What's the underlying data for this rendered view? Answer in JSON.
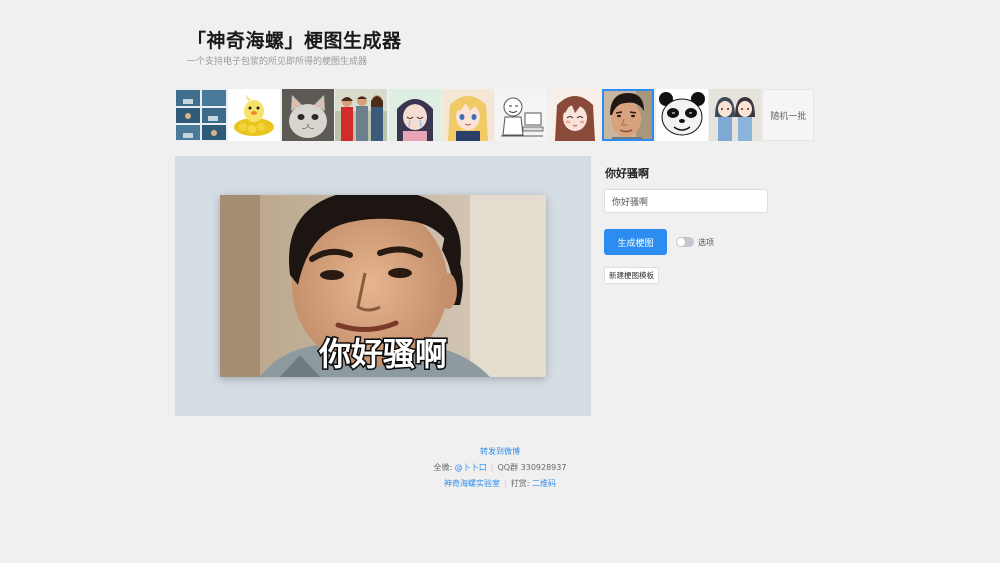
{
  "header": {
    "title": "「神奇海螺」梗图生成器",
    "subtitle": "一个支持电子包浆的所见即所得的梗图生成器"
  },
  "templates": {
    "items": [
      {
        "name": "template-comic"
      },
      {
        "name": "template-yellow-duck"
      },
      {
        "name": "template-cat"
      },
      {
        "name": "template-distracted-boyfriend"
      },
      {
        "name": "template-anime-girl-crying"
      },
      {
        "name": "template-anime-blonde"
      },
      {
        "name": "template-sketch-computer"
      },
      {
        "name": "template-anime-brown-hair"
      },
      {
        "name": "template-man-face"
      },
      {
        "name": "template-panda-face"
      },
      {
        "name": "template-anime-pair"
      }
    ],
    "selected_index": 8,
    "random_label": "随机一批"
  },
  "preview": {
    "caption": "你好骚啊"
  },
  "form": {
    "field_label": "你好骚啊",
    "input_value": "你好骚啊",
    "generate_label": "生成梗图",
    "toggle_label": "选项",
    "toggle_on": false,
    "new_template_label": "新建梗图模板"
  },
  "footer": {
    "share_link": "转发到微博",
    "author_prefix": "全微:",
    "author_link": "@卜卜口",
    "qq_group": "QQ群 330928937",
    "lab_link": "神奇海螺实验室",
    "tip_prefix": "打赏:",
    "tip_link": "二维码"
  },
  "colors": {
    "accent": "#2d8cf0",
    "background": "#f0f0f0",
    "preview_bg": "#d5dde4"
  }
}
